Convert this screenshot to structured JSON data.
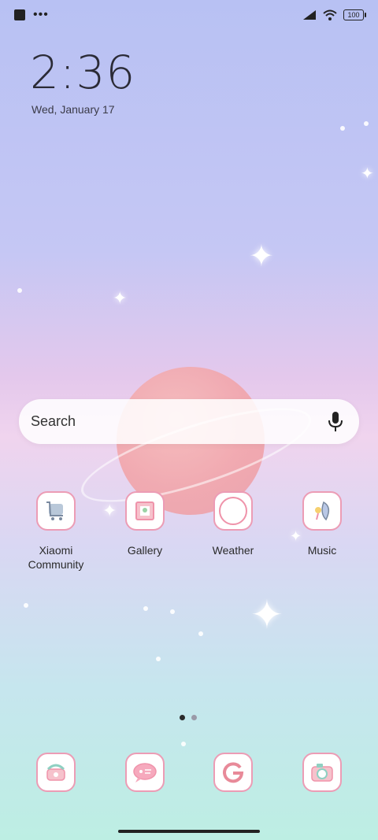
{
  "status_bar": {
    "left_icons": [
      "square-notification-icon",
      "more-dots-icon"
    ],
    "more_dots": "•••",
    "right_icons": [
      "signal-icon",
      "wifi-icon",
      "battery-icon"
    ],
    "battery": "100"
  },
  "clock": {
    "time": "2:36",
    "date": "Wed, January 17"
  },
  "search": {
    "placeholder": "Search",
    "mic_icon": "microphone-icon"
  },
  "apps": [
    {
      "label_line1": "Xiaomi",
      "label_line2": "Community",
      "icon": "shopping-cart-icon"
    },
    {
      "label": "Gallery",
      "icon": "picture-frame-icon"
    },
    {
      "label": "Weather",
      "icon": "circle-icon"
    },
    {
      "label": "Music",
      "icon": "music-leaf-icon"
    }
  ],
  "pager": {
    "pages": 2,
    "current": 1
  },
  "dock": [
    {
      "icon": "phone-icon"
    },
    {
      "icon": "chat-bubble-icon"
    },
    {
      "icon": "google-g-icon"
    },
    {
      "icon": "camera-icon"
    }
  ],
  "colors": {
    "icon_border": "#ec9cb5",
    "accent_pink": "#ef93aa",
    "text_dark": "#2a2a2a"
  }
}
